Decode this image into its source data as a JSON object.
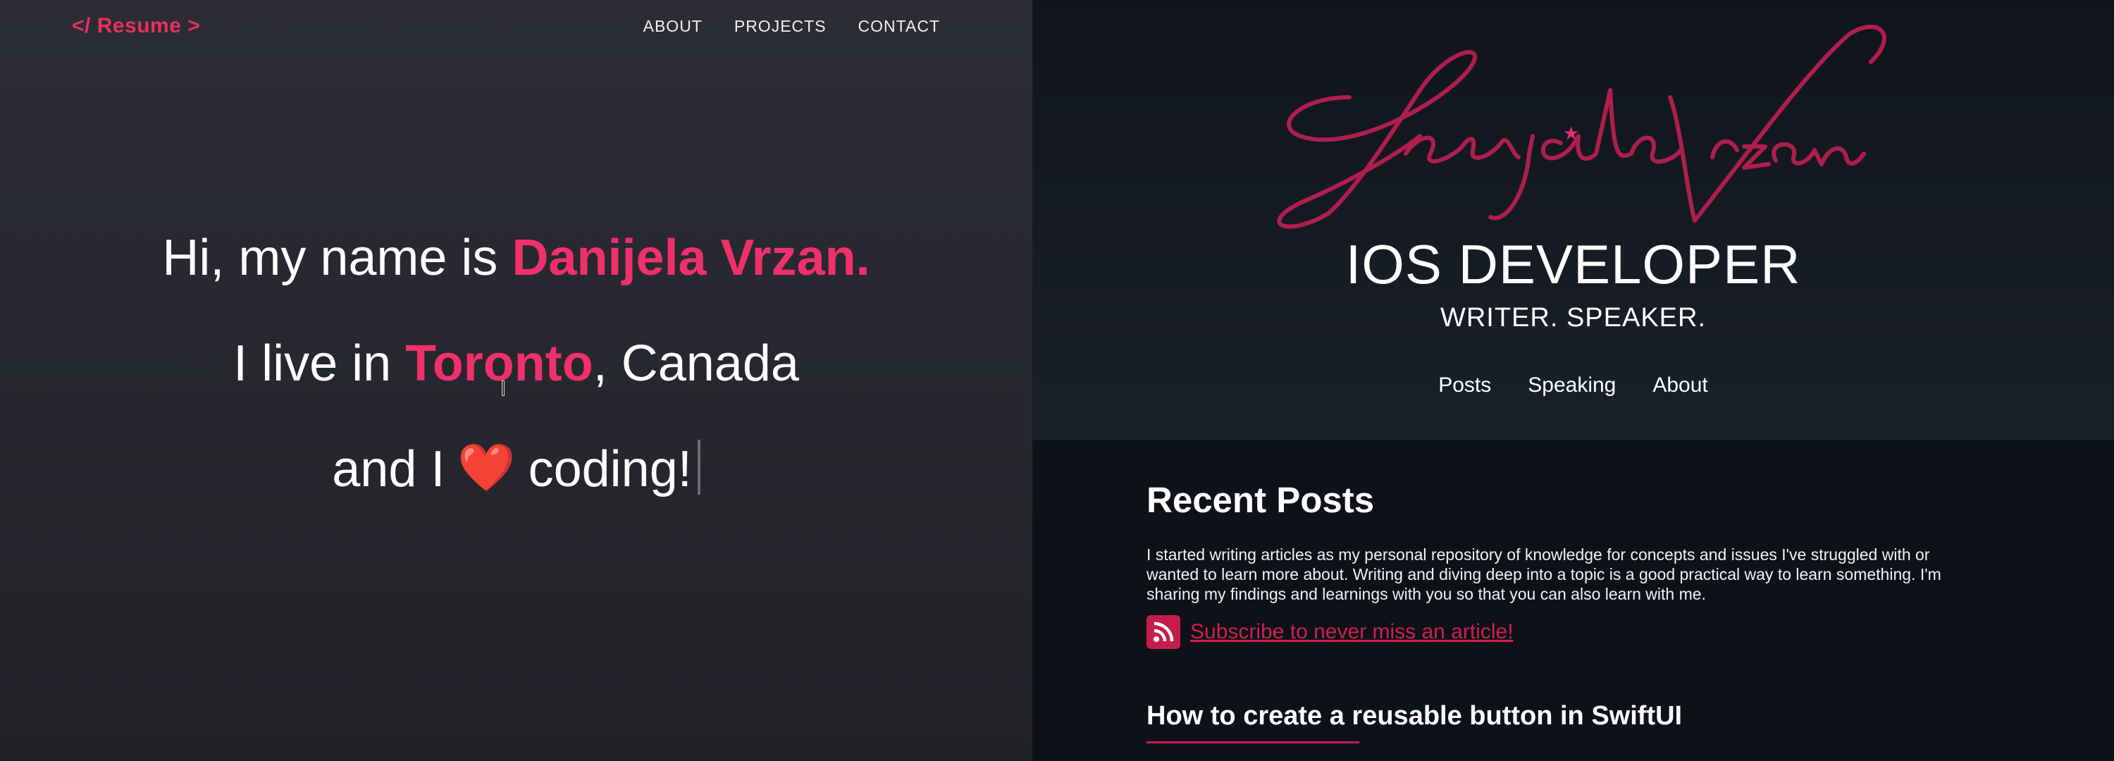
{
  "left": {
    "logo": "</ Resume >",
    "nav": [
      {
        "label": "ABOUT"
      },
      {
        "label": "PROJECTS"
      },
      {
        "label": "CONTACT"
      }
    ],
    "hero": {
      "line1_pre": "Hi, my name is ",
      "line1_name": "Danijela Vrzan.",
      "line2_pre": "I live in ",
      "line2_city": "Toronto",
      "line2_post": ", Canada",
      "line3_pre": "and I",
      "line3_heart": "❤️",
      "line3_post": "coding!"
    },
    "colors": {
      "accent": "#f0306a",
      "background": "#26272e"
    }
  },
  "right": {
    "signature": "Danijela Vrzan",
    "role": "IOS DEVELOPER",
    "subrole": "WRITER. SPEAKER.",
    "nav": [
      {
        "label": "Posts"
      },
      {
        "label": "Speaking"
      },
      {
        "label": "About"
      }
    ],
    "recent_posts": {
      "heading": "Recent Posts",
      "intro": "I started writing articles as my personal repository of knowledge for concepts and issues I've struggled with or wanted to learn more about. Writing and diving deep into a topic is a good practical way to learn something. I'm sharing my findings and learnings with you so that you can also learn with me.",
      "rss_icon": "rss-icon",
      "subscribe_label": "Subscribe to never miss an article!",
      "first_post_title": "How to create a reusable button in SwiftUI"
    },
    "colors": {
      "accent": "#c41d4c",
      "background": "#0e1218"
    }
  }
}
